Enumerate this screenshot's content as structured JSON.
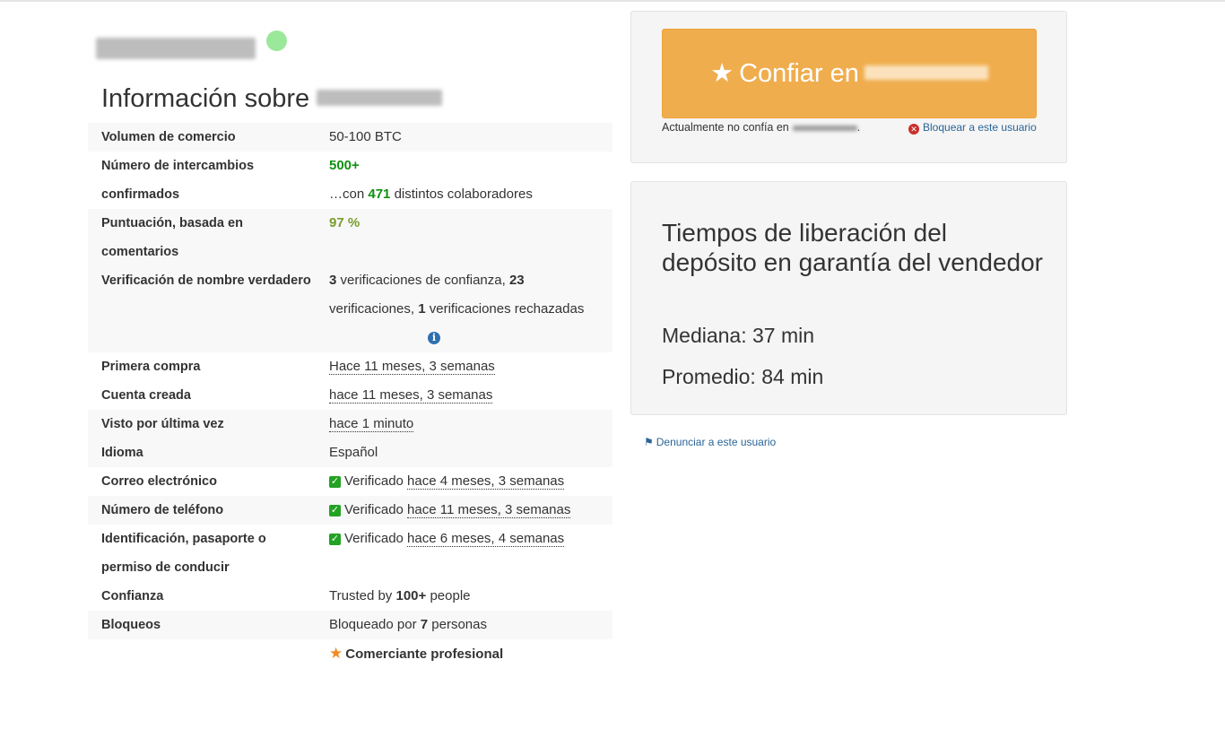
{
  "header": {
    "username_redacted": "",
    "status": "online",
    "status_color": "#9be89b"
  },
  "info": {
    "title": "Información sobre",
    "rows": {
      "volume": {
        "label": "Volumen de comercio",
        "value": "50-100 BTC"
      },
      "trades": {
        "label": "Número de intercambios confirmados",
        "value": "500+",
        "partners_prefix": "…con",
        "partners_count": "471",
        "partners_suffix": "distintos colaboradores"
      },
      "feedback": {
        "label": "Puntuación, basada en comentarios",
        "value": "97 %"
      },
      "real_name": {
        "label": "Verificación de nombre verdadero",
        "trusted_count": "3",
        "trusted_text": "verificaciones de confianza,",
        "total_count": "23",
        "total_text": "verificaciones,",
        "rejected_count": "1",
        "rejected_text": "verificaciones rechazadas"
      },
      "first_purchase": {
        "label": "Primera compra",
        "value": "Hace 11 meses, 3 semanas"
      },
      "account_created": {
        "label": "Cuenta creada",
        "value": "hace 11 meses, 3 semanas"
      },
      "last_seen": {
        "label": "Visto por última vez",
        "value": "hace 1 minuto"
      },
      "language": {
        "label": "Idioma",
        "value": "Español"
      },
      "email": {
        "label": "Correo electrónico",
        "status": "Verificado",
        "when": "hace 4 meses, 3 semanas"
      },
      "phone": {
        "label": "Número de teléfono",
        "status": "Verificado",
        "when": "hace 11 meses, 3 semanas"
      },
      "id_doc": {
        "label": "Identificación, pasaporte o permiso de conducir",
        "status": "Verificado",
        "when": "hace 6 meses, 4 semanas"
      },
      "trust": {
        "label": "Confianza",
        "prefix": "Trusted by",
        "count": "100+",
        "suffix": "people"
      },
      "blocks": {
        "label": "Bloqueos",
        "prefix": "Bloqueado por",
        "count": "7",
        "suffix": "personas"
      },
      "pro": {
        "label": "Comerciante profesional"
      }
    }
  },
  "trust_panel": {
    "button_label": "Confiar en",
    "button_color": "#f0ad4e",
    "note": "Actualmente no confía en",
    "block_link": "Bloquear a este usuario"
  },
  "release_times": {
    "title": "Tiempos de liberación del depósito en garantía del vendedor",
    "median": "Mediana: 37 min",
    "average": "Promedio: 84 min"
  },
  "report_link": "Denunciar a este usuario",
  "colors": {
    "green": "#109010",
    "link": "#2a6496"
  }
}
